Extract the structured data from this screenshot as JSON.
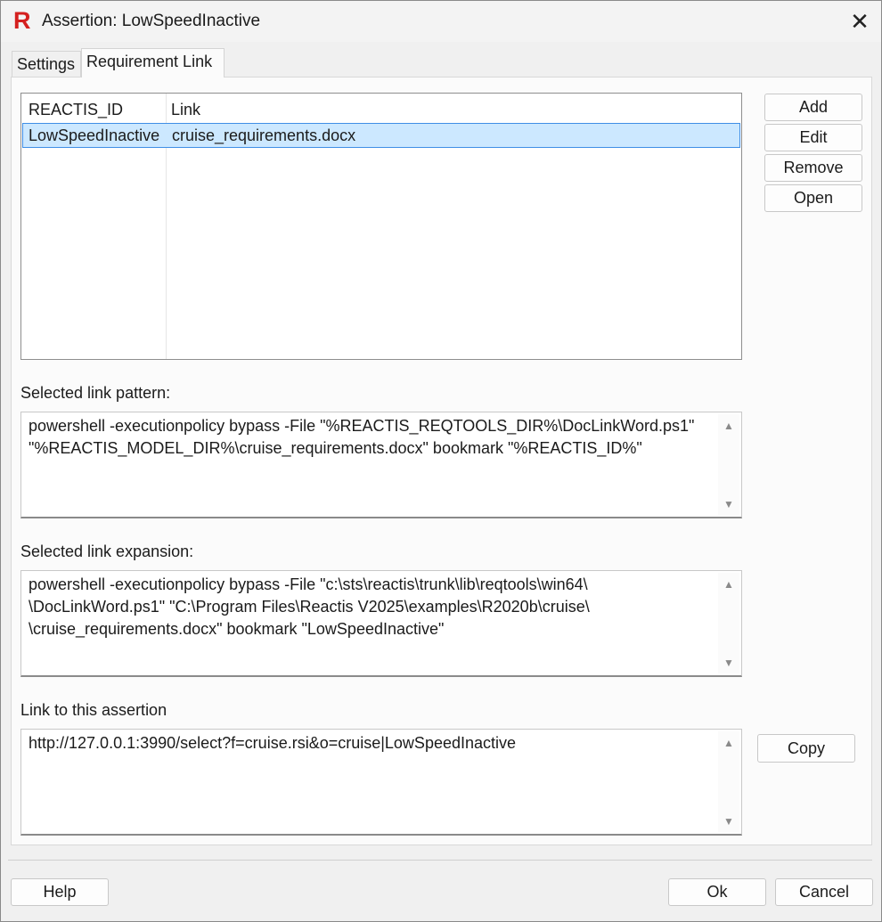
{
  "window": {
    "title": "Assertion: LowSpeedInactive",
    "close_glyph": "✕",
    "logo_letter": "R"
  },
  "tabs": [
    {
      "label": "Settings",
      "active": false
    },
    {
      "label": "Requirement Link",
      "active": true
    }
  ],
  "table": {
    "headers": [
      "REACTIS_ID",
      "Link"
    ],
    "rows": [
      {
        "reactis_id": "LowSpeedInactive",
        "link": "cruise_requirements.docx",
        "selected": true
      }
    ]
  },
  "side_buttons": {
    "add": "Add",
    "edit": "Edit",
    "remove": "Remove",
    "open": "Open"
  },
  "pattern": {
    "label": "Selected link pattern:",
    "value": "powershell -executionpolicy bypass -File \"%REACTIS_REQTOOLS_DIR%\\DocLinkWord.ps1\"\n\"%REACTIS_MODEL_DIR%\\cruise_requirements.docx\" bookmark \"%REACTIS_ID%\""
  },
  "expansion": {
    "label": "Selected link expansion:",
    "value": "powershell -executionpolicy bypass -File \"c:\\sts\\reactis\\trunk\\lib\\reqtools\\win64\\\n\\DocLinkWord.ps1\" \"C:\\Program Files\\Reactis V2025\\examples\\R2020b\\cruise\\\n\\cruise_requirements.docx\" bookmark \"LowSpeedInactive\""
  },
  "assertion_link": {
    "label": "Link to this assertion",
    "value": "http://127.0.0.1:3990/select?f=cruise.rsi&o=cruise|LowSpeedInactive",
    "copy_label": "Copy"
  },
  "footer": {
    "help": "Help",
    "ok": "Ok",
    "cancel": "Cancel"
  },
  "scroll_glyphs": {
    "up": "▲",
    "down": "▼"
  },
  "colors": {
    "logo": "#d4201f",
    "selection_bg": "#cce8ff",
    "selection_border": "#3f8ee6"
  }
}
